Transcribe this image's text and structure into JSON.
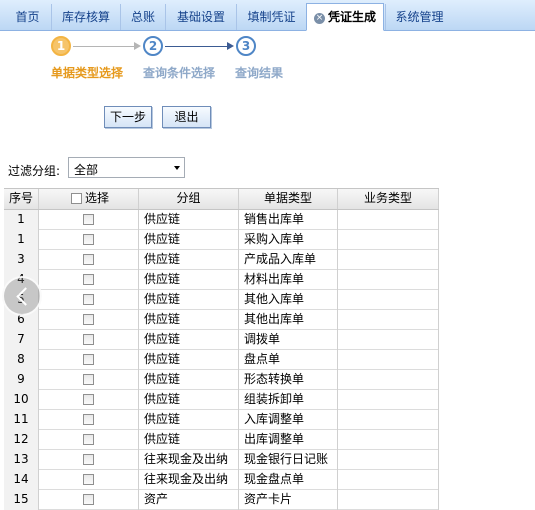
{
  "tabs": [
    {
      "label": "首页"
    },
    {
      "label": "库存核算"
    },
    {
      "label": "总账"
    },
    {
      "label": "基础设置"
    },
    {
      "label": "填制凭证"
    },
    {
      "label": "凭证生成"
    },
    {
      "label": "系统管理"
    }
  ],
  "wizard": {
    "steps": [
      {
        "num": "1",
        "label": "单据类型选择"
      },
      {
        "num": "2",
        "label": "查询条件选择"
      },
      {
        "num": "3",
        "label": "查询结果"
      }
    ]
  },
  "buttons": {
    "next": "下一步",
    "exit": "退出"
  },
  "filter": {
    "label": "过滤分组:",
    "value": "全部"
  },
  "grid": {
    "headers": {
      "no": "序号",
      "select": "选择",
      "group": "分组",
      "doc_type": "单据类型",
      "biz_type": "业务类型"
    },
    "rows": [
      {
        "no": "1",
        "group": "供应链",
        "doc_type": "销售出库单"
      },
      {
        "no": "1",
        "group": "供应链",
        "doc_type": "采购入库单"
      },
      {
        "no": "3",
        "group": "供应链",
        "doc_type": "产成品入库单"
      },
      {
        "no": "4",
        "group": "供应链",
        "doc_type": "材料出库单"
      },
      {
        "no": "5",
        "group": "供应链",
        "doc_type": "其他入库单"
      },
      {
        "no": "6",
        "group": "供应链",
        "doc_type": "其他出库单"
      },
      {
        "no": "7",
        "group": "供应链",
        "doc_type": "调拨单"
      },
      {
        "no": "8",
        "group": "供应链",
        "doc_type": "盘点单"
      },
      {
        "no": "9",
        "group": "供应链",
        "doc_type": "形态转换单"
      },
      {
        "no": "10",
        "group": "供应链",
        "doc_type": "组装拆卸单"
      },
      {
        "no": "11",
        "group": "供应链",
        "doc_type": "入库调整单"
      },
      {
        "no": "12",
        "group": "供应链",
        "doc_type": "出库调整单"
      },
      {
        "no": "13",
        "group": "往来现金及出纳",
        "doc_type": "现金银行日记账"
      },
      {
        "no": "14",
        "group": "往来现金及出纳",
        "doc_type": "现金盘点单"
      },
      {
        "no": "15",
        "group": "资产",
        "doc_type": "资产卡片"
      }
    ]
  }
}
